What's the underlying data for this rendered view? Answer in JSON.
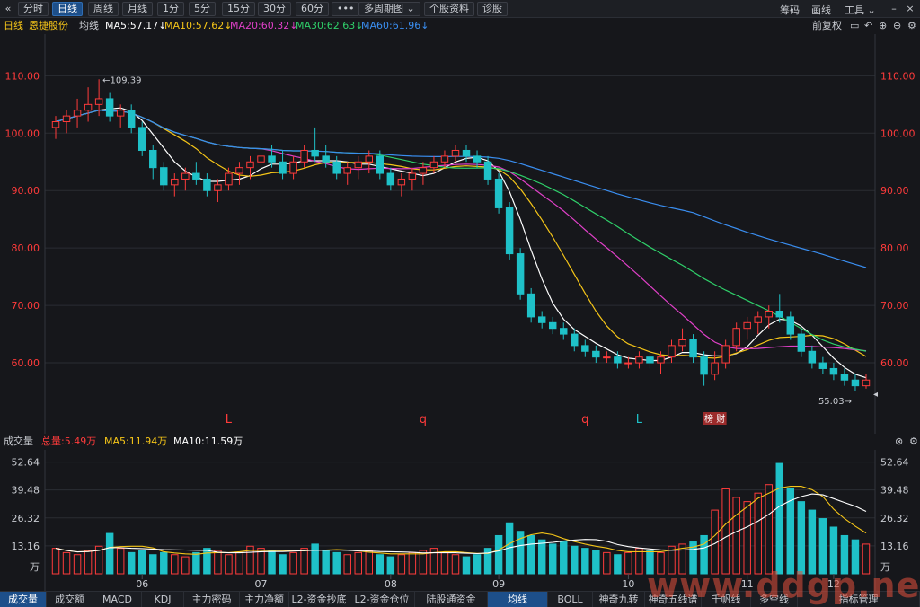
{
  "toolbar": {
    "collapse_icon": "double-chevron-left-icon",
    "tabs": [
      "分时",
      "日线",
      "周线",
      "月线",
      "1分",
      "5分",
      "15分",
      "30分",
      "60分"
    ],
    "active_tab": "日线",
    "more_label": "•••",
    "multi_period_label": "多周期图",
    "stock_info_label": "个股资料",
    "diagnose_label": "诊股",
    "chips_label": "筹码",
    "draw_label": "画线",
    "tools_label": "工具",
    "window_controls": [
      "minimize-icon",
      "maximize-icon",
      "close-icon"
    ]
  },
  "header": {
    "period": "日线",
    "stock_name": "恩捷股份",
    "ma_label": "均线",
    "ma": [
      {
        "label": "MA5:57.17",
        "color": "#ffffff"
      },
      {
        "label": "MA10:57.62",
        "color": "#f5c518"
      },
      {
        "label": "MA20:60.32",
        "color": "#e040c8"
      },
      {
        "label": "MA30:62.63",
        "color": "#2fd06a"
      },
      {
        "label": "MA60:61.96",
        "color": "#3a8ef0"
      }
    ],
    "adjust_label": "前复权"
  },
  "volume_header": {
    "title": "成交量",
    "total": "总量:5.49万",
    "ma5": "MA5:11.94万",
    "ma10": "MA10:11.59万"
  },
  "colors": {
    "up": "#ff3b3b",
    "down": "#1fc1c8",
    "ma5": "#ffffff",
    "ma10": "#f5c518",
    "ma20": "#e040c8",
    "ma30": "#2fd06a",
    "ma60": "#3a8ef0",
    "grid": "#2a2d33"
  },
  "chart_data": [
    {
      "type": "candlestick",
      "y_ticks": [
        "110.00",
        "100.00",
        "90.00",
        "80.00",
        "70.00",
        "60.00"
      ],
      "ylim": [
        50,
        116
      ],
      "x_labels": [
        "06",
        "07",
        "08",
        "09",
        "10",
        "11",
        "12"
      ],
      "annotations": {
        "high": "109.39",
        "low": "55.03"
      },
      "markers": [
        "L",
        "q",
        "q",
        "L"
      ],
      "event_label": "榜 财",
      "candles": [
        [
          101,
          103,
          99,
          102
        ],
        [
          102,
          104,
          100,
          103
        ],
        [
          103,
          106,
          101,
          104
        ],
        [
          104,
          108,
          102,
          105
        ],
        [
          105,
          109.39,
          103,
          106
        ],
        [
          106,
          107,
          102,
          103
        ],
        [
          103,
          105,
          101,
          104
        ],
        [
          104,
          105,
          100,
          101
        ],
        [
          101,
          102,
          96,
          97
        ],
        [
          97,
          98,
          92,
          94
        ],
        [
          94,
          95,
          90,
          91
        ],
        [
          91,
          93,
          89,
          92
        ],
        [
          92,
          94,
          90,
          93
        ],
        [
          93,
          95,
          91,
          92
        ],
        [
          92,
          93,
          89,
          90
        ],
        [
          90,
          92,
          88,
          91
        ],
        [
          91,
          94,
          90,
          93
        ],
        [
          93,
          95,
          91,
          94
        ],
        [
          94,
          96,
          92,
          95
        ],
        [
          95,
          97,
          93,
          96
        ],
        [
          96,
          98,
          94,
          95
        ],
        [
          95,
          97,
          92,
          93
        ],
        [
          93,
          96,
          92,
          95
        ],
        [
          95,
          98,
          94,
          97
        ],
        [
          97,
          101,
          95,
          96
        ],
        [
          96,
          98,
          94,
          95
        ],
        [
          95,
          96,
          92,
          93
        ],
        [
          93,
          95,
          91,
          94
        ],
        [
          94,
          96,
          92,
          95
        ],
        [
          95,
          97,
          93,
          96
        ],
        [
          96,
          97,
          92,
          93
        ],
        [
          93,
          94,
          90,
          91
        ],
        [
          91,
          93,
          89,
          92
        ],
        [
          92,
          94,
          90,
          93
        ],
        [
          93,
          95,
          91,
          94
        ],
        [
          94,
          96,
          93,
          95
        ],
        [
          95,
          97,
          94,
          96
        ],
        [
          96,
          98,
          95,
          97
        ],
        [
          97,
          98,
          95,
          96
        ],
        [
          96,
          97,
          94,
          95
        ],
        [
          95,
          96,
          91,
          92
        ],
        [
          92,
          93,
          86,
          87
        ],
        [
          87,
          88,
          78,
          79
        ],
        [
          79,
          80,
          71,
          72
        ],
        [
          72,
          73,
          67,
          68
        ],
        [
          68,
          69,
          66,
          67
        ],
        [
          67,
          68,
          65,
          66
        ],
        [
          66,
          67,
          64,
          65
        ],
        [
          65,
          66,
          62,
          63
        ],
        [
          63,
          64,
          61,
          62
        ],
        [
          62,
          63,
          60,
          61
        ],
        [
          61,
          62,
          60,
          61
        ],
        [
          61,
          62,
          59,
          60
        ],
        [
          60,
          61,
          59,
          60
        ],
        [
          60,
          62,
          59,
          61
        ],
        [
          61,
          63,
          59,
          60
        ],
        [
          60,
          62,
          58,
          61
        ],
        [
          61,
          64,
          60,
          63
        ],
        [
          63,
          66,
          62,
          64
        ],
        [
          64,
          65,
          60,
          61
        ],
        [
          61,
          62,
          56,
          58
        ],
        [
          58,
          62,
          57,
          60
        ],
        [
          60,
          64,
          59,
          63
        ],
        [
          63,
          67,
          62,
          66
        ],
        [
          66,
          68,
          64,
          67
        ],
        [
          67,
          69,
          65,
          68
        ],
        [
          68,
          70,
          66,
          69
        ],
        [
          69,
          72,
          67,
          68
        ],
        [
          68,
          69,
          64,
          65
        ],
        [
          65,
          66,
          61,
          62
        ],
        [
          62,
          63,
          59,
          60
        ],
        [
          60,
          61,
          58,
          59
        ],
        [
          59,
          60,
          57,
          58
        ],
        [
          58,
          59,
          56,
          57
        ],
        [
          57,
          58,
          55.03,
          56
        ],
        [
          56,
          58,
          55.5,
          57
        ]
      ]
    },
    {
      "type": "bar",
      "series": "volume",
      "y_ticks": [
        "52.64",
        "39.48",
        "26.32",
        "13.16",
        "万"
      ],
      "ylim": [
        0,
        55
      ],
      "values": [
        12,
        10,
        9,
        11,
        13,
        19,
        12,
        10,
        11,
        9,
        10,
        9,
        8,
        10,
        12,
        11,
        9,
        10,
        13,
        12,
        11,
        9,
        10,
        12,
        14,
        11,
        10,
        9,
        10,
        11,
        9,
        8,
        9,
        10,
        11,
        12,
        10,
        9,
        8,
        9,
        12,
        18,
        24,
        20,
        18,
        16,
        14,
        15,
        13,
        12,
        11,
        10,
        9,
        10,
        12,
        11,
        10,
        13,
        14,
        15,
        18,
        30,
        40,
        36,
        34,
        38,
        42,
        52,
        40,
        34,
        30,
        26,
        22,
        18,
        16,
        14
      ]
    }
  ],
  "bottom_tabs": [
    "成交量",
    "成交额",
    "MACD",
    "KDJ",
    "主力密码",
    "主力净额",
    "L2-资金抄底",
    "L2-资金仓位",
    "陆股通资金",
    "均线",
    "BOLL",
    "神奇九转",
    "神奇五线谱",
    "千帆线",
    "多空线",
    "指标管理"
  ],
  "bottom_active": [
    "成交量",
    "均线"
  ],
  "watermark": "www.ddgp.net"
}
